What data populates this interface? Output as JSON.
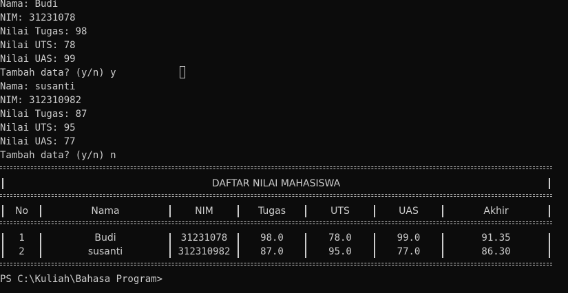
{
  "console": {
    "lines": [
      "Nama: Budi",
      "NIM: 31231078",
      "Nilai Tugas: 98",
      "Nilai UTS: 78",
      "Nilai UAS: 99",
      "Tambah data? (y/n) y",
      "Nama: susanti",
      "NIM: 312310982",
      "Nilai Tugas: 87",
      "Nilai UTS: 95",
      "Nilai UAS: 77",
      "Tambah data? (y/n) n"
    ]
  },
  "table": {
    "title": "DAFTAR NILAI MAHASISWA",
    "headers": [
      "No",
      "Nama",
      "NIM",
      "Tugas",
      "UTS",
      "UAS",
      "Akhir"
    ],
    "rows": [
      [
        "1",
        "Budi",
        "31231078",
        "98.0",
        "78.0",
        "99.0",
        "91.35"
      ],
      [
        "2",
        "susanti",
        "312310982",
        "87.0",
        "95.0",
        "77.0",
        "86.30"
      ]
    ]
  },
  "prompt": "PS C:\\Kuliah\\Bahasa Program>"
}
